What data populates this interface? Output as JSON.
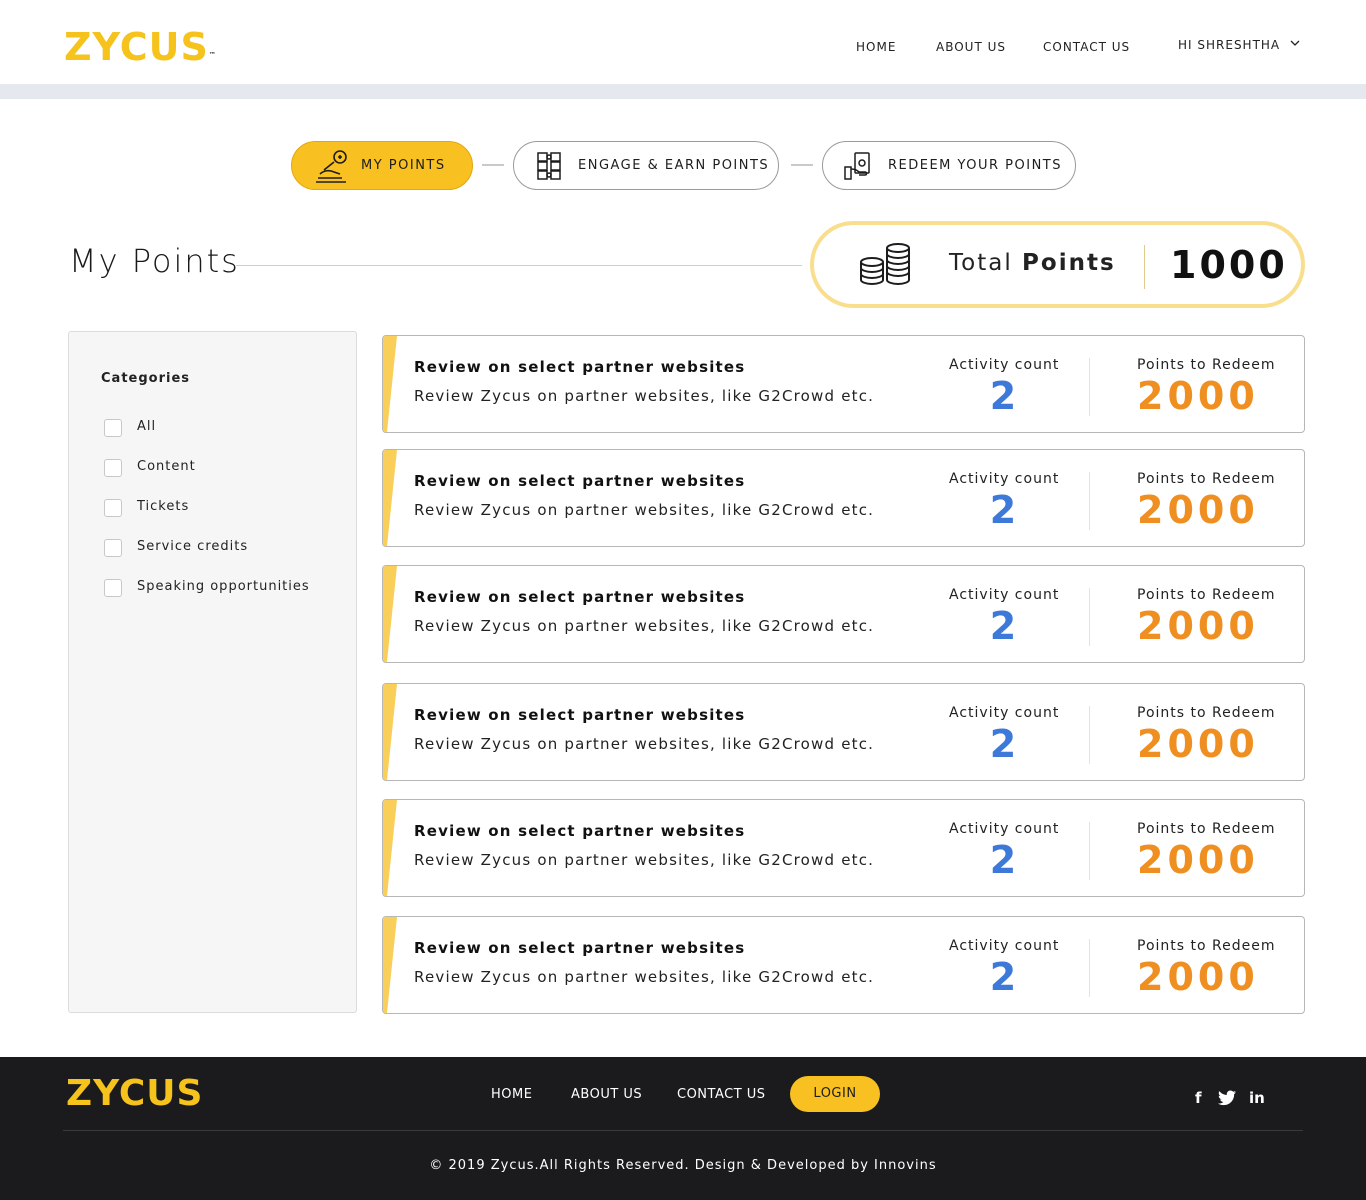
{
  "header": {
    "logo": "ZYCUS",
    "logo_tm": "™",
    "nav": {
      "home": "HOME",
      "about": "ABOUT US",
      "contact": "CONTACT US"
    },
    "user_greeting": "HI SHRESHTHA"
  },
  "steps": [
    {
      "label": "MY POINTS",
      "active": true,
      "icon": "hand-coin-icon"
    },
    {
      "label": "ENGAGE & EARN POINTS",
      "active": false,
      "icon": "puzzle-icon"
    },
    {
      "label": "REDEEM YOUR POINTS",
      "active": false,
      "icon": "hand-cash-icon"
    }
  ],
  "page_title": "My Points",
  "total": {
    "label_prefix": "Total",
    "label_bold": "Points",
    "value": "1000",
    "icon": "coins-stack-icon"
  },
  "categories": {
    "title": "Categories",
    "items": [
      {
        "label": "All",
        "checked": false
      },
      {
        "label": "Content",
        "checked": false
      },
      {
        "label": "Tickets",
        "checked": false
      },
      {
        "label": "Service credits",
        "checked": false
      },
      {
        "label": "Speaking opportunities",
        "checked": false
      }
    ]
  },
  "activities": [
    {
      "title": "Review on select partner websites",
      "description": "Review Zycus on partner websites, like G2Crowd etc.",
      "count_label": "Activity count",
      "count": "2",
      "points_label": "Points to Redeem",
      "points": "2000"
    },
    {
      "title": "Review on select partner websites",
      "description": "Review Zycus on partner websites, like G2Crowd etc.",
      "count_label": "Activity count",
      "count": "2",
      "points_label": "Points to Redeem",
      "points": "2000"
    },
    {
      "title": "Review on select partner websites",
      "description": "Review Zycus on partner websites, like G2Crowd etc.",
      "count_label": "Activity count",
      "count": "2",
      "points_label": "Points to Redeem",
      "points": "2000"
    },
    {
      "title": "Review on select partner websites",
      "description": "Review Zycus on partner websites, like G2Crowd etc.",
      "count_label": "Activity count",
      "count": "2",
      "points_label": "Points to Redeem",
      "points": "2000"
    },
    {
      "title": "Review on select partner websites",
      "description": "Review Zycus on partner websites, like G2Crowd etc.",
      "count_label": "Activity count",
      "count": "2",
      "points_label": "Points to Redeem",
      "points": "2000"
    },
    {
      "title": "Review on select partner websites",
      "description": "Review Zycus on partner websites, like G2Crowd etc.",
      "count_label": "Activity count",
      "count": "2",
      "points_label": "Points to Redeem",
      "points": "2000"
    }
  ],
  "footer": {
    "logo": "ZYCUS",
    "nav": {
      "home": "HOME",
      "about": "ABOUT US",
      "contact": "CONTACT US"
    },
    "login": "LOGIN",
    "social": {
      "facebook": "f",
      "twitter": "twitter-icon",
      "linkedin": "in"
    },
    "copyright": "© 2019 Zycus.All Rights Reserved. Design & Developed by Innovins"
  },
  "colors": {
    "brand_yellow": "#f9c022",
    "count_blue": "#3d79d8",
    "points_orange": "#f08f21",
    "footer_bg": "#1b1b1d"
  }
}
